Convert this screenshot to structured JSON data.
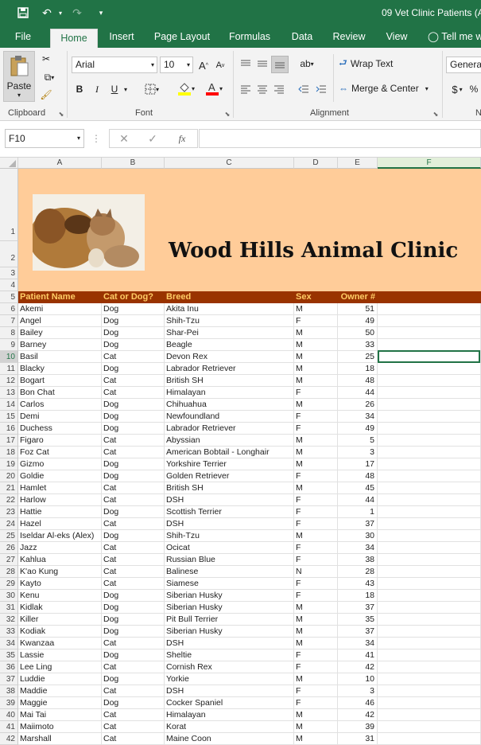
{
  "window": {
    "title": "09 Vet Clinic Patients (A"
  },
  "tabs": [
    {
      "label": "File"
    },
    {
      "label": "Home"
    },
    {
      "label": "Insert"
    },
    {
      "label": "Page Layout"
    },
    {
      "label": "Formulas"
    },
    {
      "label": "Data"
    },
    {
      "label": "Review"
    },
    {
      "label": "View"
    },
    {
      "label": "Tell me w"
    }
  ],
  "ribbon": {
    "clipboard": {
      "paste": "Paste",
      "label": "Clipboard"
    },
    "font": {
      "name": "Arial",
      "size": "10",
      "label": "Font",
      "bold": "B",
      "italic": "I",
      "underline": "U"
    },
    "alignment": {
      "wrap": "Wrap Text",
      "merge": "Merge & Center",
      "label": "Alignment"
    },
    "number": {
      "format": "General",
      "currency": "$",
      "percent": "%",
      "label": "N"
    }
  },
  "formula_bar": {
    "name_box": "F10",
    "fx": "fx",
    "formula": ""
  },
  "columns": [
    "A",
    "B",
    "C",
    "D",
    "E",
    "F"
  ],
  "sheet": {
    "title": "Wood Hills Animal Clinic",
    "headers": [
      "Patient Name",
      "Cat or Dog?",
      "Breed",
      "Sex",
      "Owner #"
    ],
    "rows": [
      [
        "Akemi",
        "Dog",
        "Akita Inu",
        "M",
        "51"
      ],
      [
        "Angel",
        "Dog",
        "Shih-Tzu",
        "F",
        "49"
      ],
      [
        "Bailey",
        "Dog",
        "Shar-Pei",
        "M",
        "50"
      ],
      [
        "Barney",
        "Dog",
        "Beagle",
        "M",
        "33"
      ],
      [
        "Basil",
        "Cat",
        "Devon Rex",
        "M",
        "25"
      ],
      [
        "Blacky",
        "Dog",
        "Labrador Retriever",
        "M",
        "18"
      ],
      [
        "Bogart",
        "Cat",
        "British SH",
        "M",
        "48"
      ],
      [
        "Bon Chat",
        "Cat",
        "Himalayan",
        "F",
        "44"
      ],
      [
        "Carlos",
        "Dog",
        "Chihuahua",
        "M",
        "26"
      ],
      [
        "Demi",
        "Dog",
        "Newfoundland",
        "F",
        "34"
      ],
      [
        "Duchess",
        "Dog",
        "Labrador Retriever",
        "F",
        "49"
      ],
      [
        "Figaro",
        "Cat",
        "Abyssian",
        "M",
        "5"
      ],
      [
        "Foz Cat",
        "Cat",
        "American Bobtail - Longhair",
        "M",
        "3"
      ],
      [
        "Gizmo",
        "Dog",
        "Yorkshire Terrier",
        "M",
        "17"
      ],
      [
        "Goldie",
        "Dog",
        "Golden Retriever",
        "F",
        "48"
      ],
      [
        "Hamlet",
        "Cat",
        "British SH",
        "M",
        "45"
      ],
      [
        "Harlow",
        "Cat",
        "DSH",
        "F",
        "44"
      ],
      [
        "Hattie",
        "Dog",
        "Scottish Terrier",
        "F",
        "1"
      ],
      [
        "Hazel",
        "Cat",
        "DSH",
        "F",
        "37"
      ],
      [
        "Iseldar Al-eks (Alex)",
        "Dog",
        "Shih-Tzu",
        "M",
        "30"
      ],
      [
        "Jazz",
        "Cat",
        "Ocicat",
        "F",
        "34"
      ],
      [
        "Kahlua",
        "Cat",
        "Russian Blue",
        "F",
        "38"
      ],
      [
        "K'ao Kung",
        "Cat",
        "Balinese",
        "N",
        "28"
      ],
      [
        "Kayto",
        "Cat",
        "Siamese",
        "F",
        "43"
      ],
      [
        "Kenu",
        "Dog",
        "Siberian Husky",
        "F",
        "18"
      ],
      [
        "Kidlak",
        "Dog",
        "Siberian Husky",
        "M",
        "37"
      ],
      [
        "Killer",
        "Dog",
        "Pit Bull Terrier",
        "M",
        "35"
      ],
      [
        "Kodiak",
        "Dog",
        "Siberian Husky",
        "M",
        "37"
      ],
      [
        "Kwanzaa",
        "Cat",
        "DSH",
        "M",
        "34"
      ],
      [
        "Lassie",
        "Dog",
        "Sheltie",
        "F",
        "41"
      ],
      [
        "Lee Ling",
        "Cat",
        "Cornish Rex",
        "F",
        "42"
      ],
      [
        "Luddie",
        "Dog",
        "Yorkie",
        "M",
        "10"
      ],
      [
        "Maddie",
        "Cat",
        "DSH",
        "F",
        "3"
      ],
      [
        "Maggie",
        "Dog",
        "Cocker Spaniel",
        "F",
        "46"
      ],
      [
        "Mai Tai",
        "Cat",
        "Himalayan",
        "M",
        "42"
      ],
      [
        "Maiimoto",
        "Cat",
        "Korat",
        "M",
        "39"
      ],
      [
        "Marshall",
        "Cat",
        "Maine Coon",
        "M",
        "31"
      ]
    ]
  }
}
